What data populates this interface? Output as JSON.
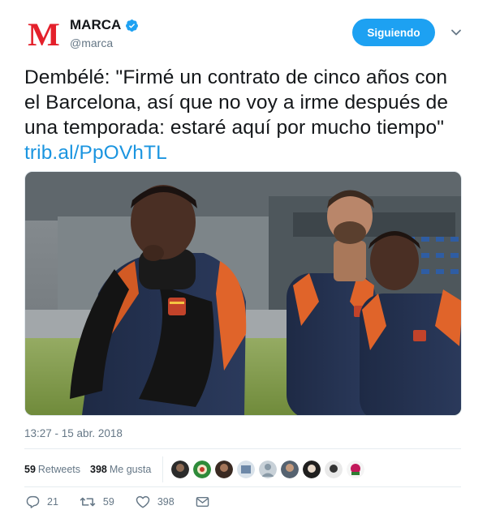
{
  "header": {
    "logo_text": "M",
    "display_name": "MARCA",
    "handle": "@marca",
    "follow_label": "Siguiendo"
  },
  "tweet": {
    "text": "Dembélé: \"Firmé un contrato de cinco años con el Barcelona, así que no voy a irme después de una temporada: estaré aquí por mucho tiempo\" ",
    "link": "trib.al/PpOVhTL",
    "timestamp": "13:27 - 15 abr. 2018"
  },
  "stats": {
    "retweets_count": "59",
    "retweets_label": "Retweets",
    "likes_count": "398",
    "likes_label": "Me gusta"
  },
  "actions": {
    "reply_count": "21",
    "retweet_count": "59",
    "like_count": "398"
  },
  "colors": {
    "accent": "#1da1f2",
    "link": "#1b95e0",
    "brand": "#e4202b",
    "muted": "#657786"
  }
}
